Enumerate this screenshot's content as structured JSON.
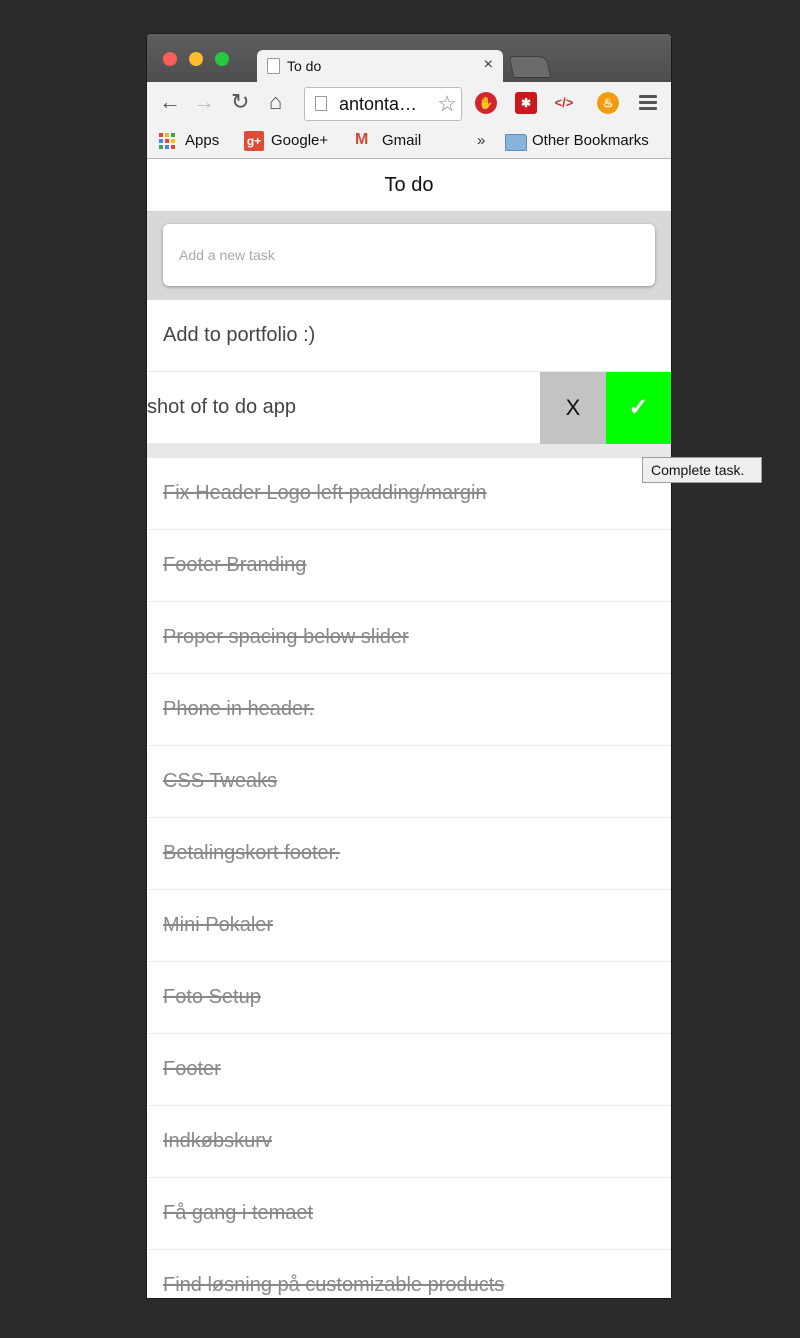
{
  "browser": {
    "tab_title": "To do",
    "tab_close": "×",
    "address": "antonta…",
    "bookmarks": {
      "apps": "Apps",
      "google_plus": "Google+",
      "gmail": "Gmail",
      "more": "»",
      "other": "Other Bookmarks"
    },
    "extensions": [
      "adblock-icon",
      "lastpass-icon",
      "code-icon",
      "firefox-style-icon"
    ]
  },
  "app": {
    "title": "To do",
    "add_placeholder": "Add a new task",
    "active_tasks": [
      "Add to portfolio :)",
      "shot of to do app"
    ],
    "swipe_actions": {
      "delete": "X",
      "complete": "✓"
    },
    "completed_tasks": [
      "Fix Header Logo left padding/margin",
      "Footer Branding",
      "Proper spacing below slider",
      "Phone in header.",
      "CSS Tweaks",
      "Betalingskort footer.",
      "Mini Pokaler",
      "Foto Setup",
      "Footer",
      "Indkøbskurv",
      "Få gang i temaet",
      "Find løsning på customizable products"
    ]
  },
  "tooltip": "Complete task.",
  "colors": {
    "complete_button": "#00ff00",
    "delete_button": "#c3c3c3",
    "backdrop": "#2b2b2b"
  }
}
